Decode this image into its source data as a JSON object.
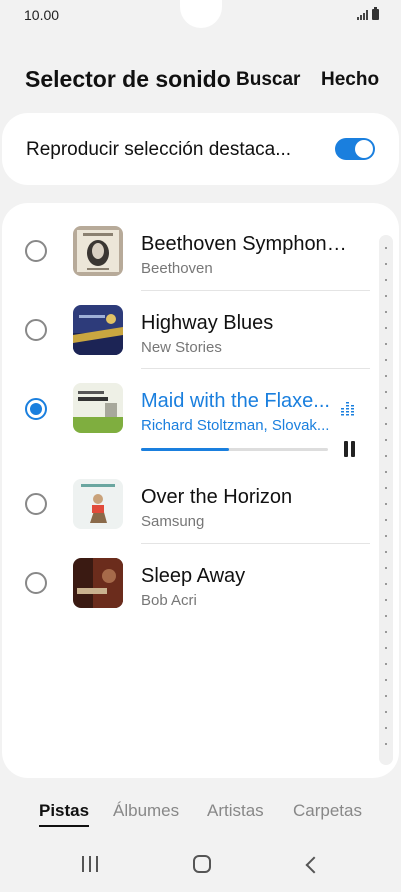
{
  "status_bar": {
    "time": "10.00"
  },
  "header": {
    "title": "Selector de sonido",
    "search_label": "Buscar",
    "done_label": "Hecho"
  },
  "highlight_toggle": {
    "label": "Reproducir selección destaca...",
    "enabled": true
  },
  "tracks": [
    {
      "title": "Beethoven Symphony...",
      "artist": "Beethoven",
      "selected": false
    },
    {
      "title": "Highway Blues",
      "artist": "New Stories",
      "selected": false
    },
    {
      "title": "Maid with the Flaxe...",
      "artist": "Richard Stoltzman, Slovak...",
      "selected": true,
      "progress": 0.47,
      "state": "playing"
    },
    {
      "title": "Over the Horizon",
      "artist": "Samsung",
      "selected": false
    },
    {
      "title": "Sleep Away",
      "artist": "Bob Acri",
      "selected": false
    }
  ],
  "tabs": [
    {
      "label": "Pistas",
      "active": true
    },
    {
      "label": "Álbumes",
      "active": false
    },
    {
      "label": "Artistas",
      "active": false
    },
    {
      "label": "Carpetas",
      "active": false
    }
  ],
  "colors": {
    "accent": "#1a7fde",
    "background": "#f2f2f2",
    "card": "#ffffff"
  },
  "icons": {
    "signal": "signal-icon",
    "battery": "battery-icon",
    "equalizer": "equalizer-icon",
    "pause": "pause-icon",
    "recents": "recents-icon",
    "home": "home-icon",
    "back": "back-icon"
  }
}
